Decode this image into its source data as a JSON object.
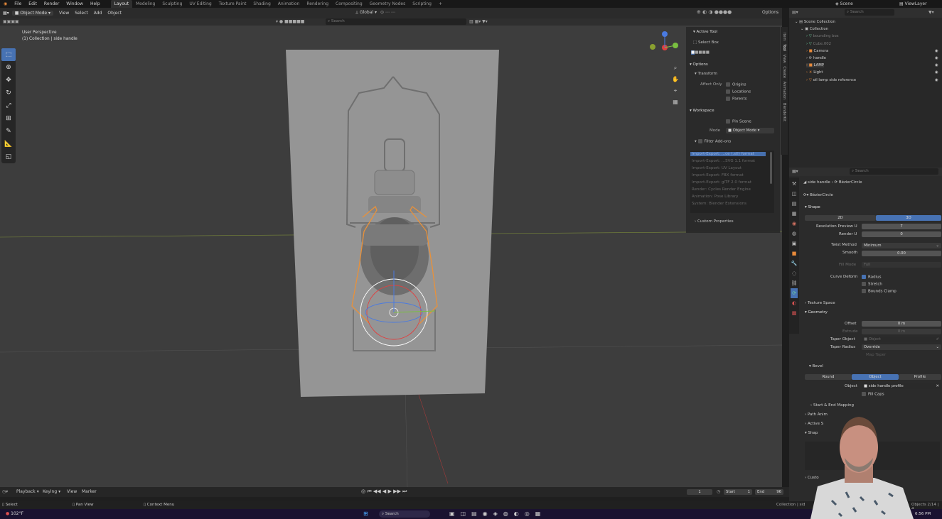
{
  "menu": [
    "File",
    "Edit",
    "Render",
    "Window",
    "Help"
  ],
  "workspaces": [
    "Layout",
    "Modeling",
    "Sculpting",
    "UV Editing",
    "Texture Paint",
    "Shading",
    "Animation",
    "Rendering",
    "Compositing",
    "Geometry Nodes",
    "Scripting"
  ],
  "active_workspace": "Layout",
  "top_right": {
    "scene": "Scene",
    "view_layer": "ViewLayer"
  },
  "viewport_header": {
    "mode": "Object Mode",
    "menus": [
      "View",
      "Select",
      "Add",
      "Object"
    ],
    "transform": "Global",
    "options": "Options",
    "search_placeholder": "Search"
  },
  "viewport_info": {
    "line1": "User Perspective",
    "line2": "(1) Collection | side handle"
  },
  "npanel": {
    "active_tool_label": "Active Tool",
    "select_box": "Select Box",
    "options": "Options",
    "transform": "Transform",
    "affect_only": "Affect Only",
    "origins": "Origins",
    "locations": "Locations",
    "parents": "Parents",
    "workspace": "Workspace",
    "pin_scene": "Pin Scene",
    "mode_label": "Mode",
    "mode_value": "Object Mode",
    "filter_addons": "Filter Add-ons",
    "addons": [
      "Import-Export: ...ce (.stl) format",
      "Import-Export: ...SVG 1.1 format",
      "Import-Export: UV Layout",
      "Import-Export: FBX format",
      "Import-Export: glTF 2.0 format",
      "Render: Cycles Render Engine",
      "Animation: Pose Library",
      "System: Blender Extensions"
    ],
    "custom_properties": "Custom Properties",
    "tabs": [
      "Item",
      "Tool",
      "View",
      "Create",
      "Animation",
      "BlenderKit"
    ]
  },
  "outliner": {
    "search_placeholder": "Search",
    "items": [
      {
        "label": "Scene Collection",
        "indent": 0
      },
      {
        "label": "Collection",
        "indent": 1
      },
      {
        "label": "bounding box",
        "indent": 2
      },
      {
        "label": "Cube.002",
        "indent": 2
      },
      {
        "label": "Camera",
        "indent": 2
      },
      {
        "label": "handle",
        "indent": 2
      },
      {
        "label": "LAMP",
        "indent": 2
      },
      {
        "label": "Light",
        "indent": 2
      },
      {
        "label": "oil lamp side reference",
        "indent": 2
      }
    ]
  },
  "properties": {
    "search_placeholder": "Search",
    "breadcrumb_object": "side handle",
    "breadcrumb_data": "BézierCircle",
    "data_name": "BézierCircle",
    "shape_section": "Shape",
    "dim_2d": "2D",
    "dim_3d": "3D",
    "resolution_preview_label": "Resolution Preview U",
    "resolution_preview_value": "7",
    "render_u_label": "Render U",
    "render_u_value": "0",
    "twist_method_label": "Twist Method",
    "twist_method_value": "Minimum",
    "smooth_label": "Smooth",
    "smooth_value": "0.00",
    "fill_mode_label": "Fill Mode",
    "fill_mode_value": "Full",
    "curve_deform_label": "Curve Deform",
    "radius": "Radius",
    "stretch": "Stretch",
    "bounds_clamp": "Bounds Clamp",
    "texture_space": "Texture Space",
    "geometry": "Geometry",
    "offset_label": "Offset",
    "offset_value": "0 m",
    "extrude_label": "Extrude",
    "extrude_value": "0 m",
    "taper_object_label": "Taper Object",
    "taper_object_placeholder": "Object",
    "taper_radius_label": "Taper Radius",
    "taper_radius_value": "Override",
    "map_taper": "Map Taper",
    "bevel": "Bevel",
    "bevel_modes": [
      "Round",
      "Object",
      "Profile"
    ],
    "bevel_active": "Object",
    "object_label": "Object",
    "object_value": "side handle profile",
    "fill_caps": "Fill Caps",
    "start_end_mapping": "Start & End Mapping",
    "path_animation": "Path Anim",
    "active_spline": "Active S",
    "shape_keys": "Shap",
    "custom": "Custo"
  },
  "timeline": {
    "menus": [
      "Playback",
      "Keying",
      "View",
      "Marker"
    ],
    "current_frame": "1",
    "start_label": "Start",
    "start_value": "1",
    "end_label": "End",
    "end_value": "96"
  },
  "status": {
    "select": "Select",
    "pan_view": "Pan View",
    "context_menu": "Context Menu",
    "collection": "Collection | sid",
    "objects": "Objects 2/14 | 4"
  },
  "taskbar": {
    "temp": "102°F",
    "search": "Search",
    "time": "6:56 PM"
  },
  "colors": {
    "accent": "#4772b3",
    "selection_orange": "#e8913a",
    "viewport_bg": "#3d3d3d"
  }
}
